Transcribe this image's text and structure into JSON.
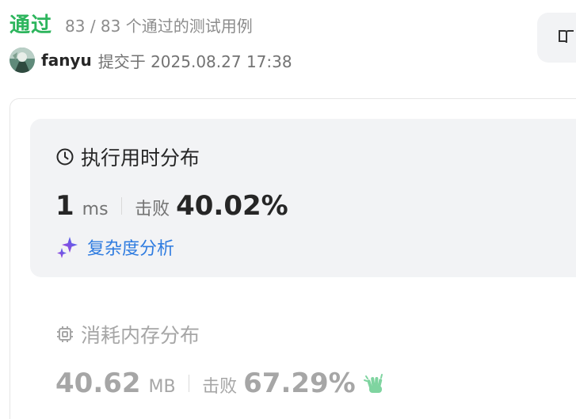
{
  "header": {
    "status_title": "通过",
    "test_count": "83 / 83 个通过的测试用例"
  },
  "submission": {
    "username": "fanyu",
    "submitted_at": "提交于 2025.08.27 17:38"
  },
  "runtime": {
    "heading": "执行用时分布",
    "value": "1",
    "unit": "ms",
    "beat_label": "击败",
    "beat_percent": "40.02%",
    "analysis_link": "复杂度分析"
  },
  "memory": {
    "heading": "消耗内存分布",
    "value": "40.62",
    "unit": "MB",
    "beat_label": "击败",
    "beat_percent": "67.29%"
  },
  "icons": {
    "runtime": "clock-icon",
    "analysis": "sparkle-icon",
    "memory": "chip-icon",
    "celebrate": "clapping-hands-icon",
    "corner": "book-icon"
  },
  "colors": {
    "accepted": "#2db55d",
    "link": "#2f7ce0",
    "panel_bg": "#f2f3f5"
  }
}
